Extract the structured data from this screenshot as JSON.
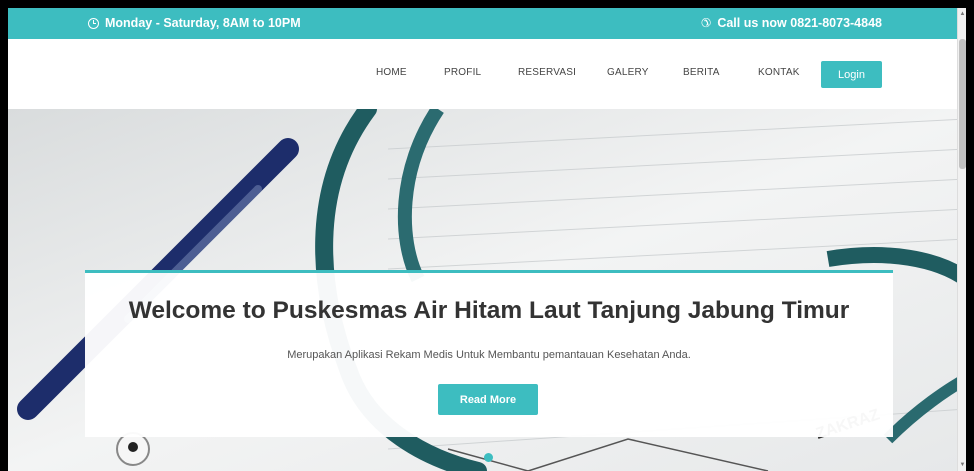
{
  "topbar": {
    "hours": "Monday - Saturday, 8AM to 10PM",
    "phone": "Call us now 0821-8073-4848"
  },
  "nav": {
    "items": [
      "HOME",
      "PROFIL",
      "RESERVASI",
      "GALERY",
      "BERITA",
      "KONTAK"
    ],
    "login_label": "Login"
  },
  "hero": {
    "title": "Welcome to Puskesmas Air Hitam Laut Tanjung Jabung Timur",
    "subtitle": "Merupakan Aplikasi Rekam Medis Untuk Membantu pemantauan Kesehatan Anda.",
    "button_label": "Read More"
  },
  "colors": {
    "accent": "#3dbdc0"
  },
  "icons": {
    "hours": "clock-icon",
    "phone": "phone-icon"
  }
}
